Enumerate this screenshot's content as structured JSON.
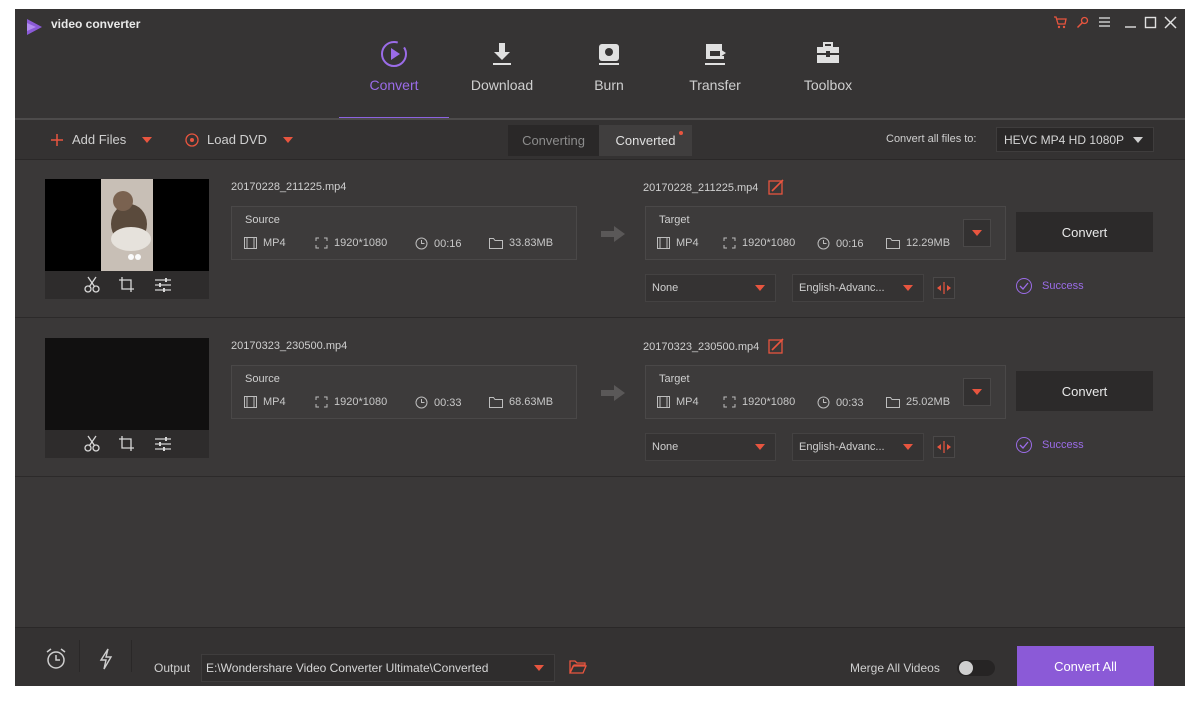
{
  "app": {
    "title": "video converter"
  },
  "nav": {
    "items": [
      {
        "label": "Convert",
        "icon": "convert-icon",
        "active": true
      },
      {
        "label": "Download",
        "icon": "download-icon",
        "active": false
      },
      {
        "label": "Burn",
        "icon": "burn-icon",
        "active": false
      },
      {
        "label": "Transfer",
        "icon": "transfer-icon",
        "active": false
      },
      {
        "label": "Toolbox",
        "icon": "toolbox-icon",
        "active": false
      }
    ]
  },
  "toolbar": {
    "add_files": "Add Files",
    "load_dvd": "Load DVD",
    "tab_converting": "Converting",
    "tab_converted": "Converted",
    "convert_all_label": "Convert all files to:",
    "format_value": "HEVC MP4 HD 1080P"
  },
  "files": [
    {
      "source_name": "20170228_211225.mp4",
      "target_name": "20170228_211225.mp4",
      "source": {
        "title": "Source",
        "format": "MP4",
        "resolution": "1920*1080",
        "duration": "00:16",
        "size": "33.83MB"
      },
      "target": {
        "title": "Target",
        "format": "MP4",
        "resolution": "1920*1080",
        "duration": "00:16",
        "size": "12.29MB"
      },
      "subtitle": "None",
      "audio": "English-Advanc...",
      "convert_label": "Convert",
      "status": "Success"
    },
    {
      "source_name": "20170323_230500.mp4",
      "target_name": "20170323_230500.mp4",
      "source": {
        "title": "Source",
        "format": "MP4",
        "resolution": "1920*1080",
        "duration": "00:33",
        "size": "68.63MB"
      },
      "target": {
        "title": "Target",
        "format": "MP4",
        "resolution": "1920*1080",
        "duration": "00:33",
        "size": "25.02MB"
      },
      "subtitle": "None",
      "audio": "English-Advanc...",
      "convert_label": "Convert",
      "status": "Success"
    }
  ],
  "bottom": {
    "output_label": "Output",
    "output_path": "E:\\Wondershare Video Converter Ultimate\\Converted",
    "merge_label": "Merge All Videos",
    "merge_on": false,
    "convert_all": "Convert All"
  },
  "colors": {
    "accent": "#8b5ad7",
    "accent_text": "#9b6ce8",
    "warning": "#e8553f",
    "background": "#3a3838"
  }
}
